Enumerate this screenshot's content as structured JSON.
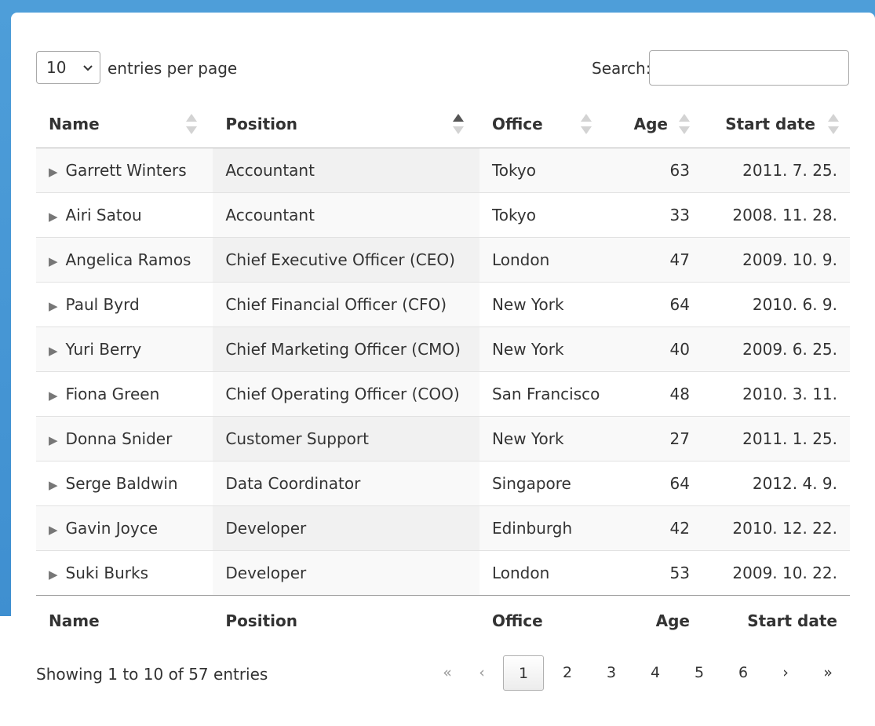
{
  "controls": {
    "page_length": "10",
    "length_label": "entries per page",
    "search_label": "Search:",
    "search_value": ""
  },
  "columns": [
    "Name",
    "Position",
    "Office",
    "Age",
    "Start date"
  ],
  "rows": [
    {
      "name": "Garrett Winters",
      "position": "Accountant",
      "office": "Tokyo",
      "age": "63",
      "start": "2011. 7. 25."
    },
    {
      "name": "Airi Satou",
      "position": "Accountant",
      "office": "Tokyo",
      "age": "33",
      "start": "2008. 11. 28."
    },
    {
      "name": "Angelica Ramos",
      "position": "Chief Executive Officer (CEO)",
      "office": "London",
      "age": "47",
      "start": "2009. 10. 9."
    },
    {
      "name": "Paul Byrd",
      "position": "Chief Financial Officer (CFO)",
      "office": "New York",
      "age": "64",
      "start": "2010. 6. 9."
    },
    {
      "name": "Yuri Berry",
      "position": "Chief Marketing Officer (CMO)",
      "office": "New York",
      "age": "40",
      "start": "2009. 6. 25."
    },
    {
      "name": "Fiona Green",
      "position": "Chief Operating Officer (COO)",
      "office": "San Francisco",
      "age": "48",
      "start": "2010. 3. 11."
    },
    {
      "name": "Donna Snider",
      "position": "Customer Support",
      "office": "New York",
      "age": "27",
      "start": "2011. 1. 25."
    },
    {
      "name": "Serge Baldwin",
      "position": "Data Coordinator",
      "office": "Singapore",
      "age": "64",
      "start": "2012. 4. 9."
    },
    {
      "name": "Gavin Joyce",
      "position": "Developer",
      "office": "Edinburgh",
      "age": "42",
      "start": "2010. 12. 22."
    },
    {
      "name": "Suki Burks",
      "position": "Developer",
      "office": "London",
      "age": "53",
      "start": "2009. 10. 22."
    }
  ],
  "footer": {
    "info": "Showing 1 to 10 of 57 entries",
    "pager": {
      "first": "«",
      "prev": "‹",
      "pages": [
        "1",
        "2",
        "3",
        "4",
        "5",
        "6"
      ],
      "current": "1",
      "next": "›",
      "last": "»"
    }
  }
}
